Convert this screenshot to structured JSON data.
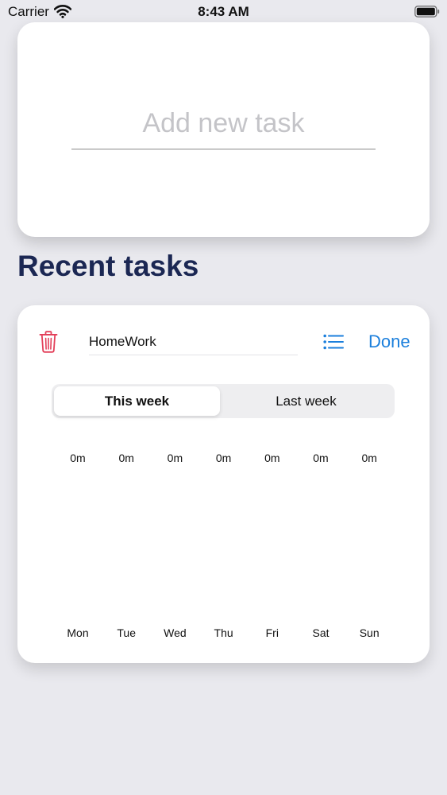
{
  "status_bar": {
    "carrier": "Carrier",
    "time": "8:43 AM"
  },
  "add_task": {
    "placeholder": "Add new task",
    "value": ""
  },
  "recent": {
    "title": "Recent tasks",
    "task": {
      "name": "HomeWork",
      "done_label": "Done"
    },
    "segments": {
      "this_week": "This week",
      "last_week": "Last week",
      "selected": "This week"
    },
    "chart_data": {
      "type": "bar",
      "categories": [
        "Mon",
        "Tue",
        "Wed",
        "Thu",
        "Fri",
        "Sat",
        "Sun"
      ],
      "values": [
        0,
        0,
        0,
        0,
        0,
        0,
        0
      ],
      "value_labels": [
        "0m",
        "0m",
        "0m",
        "0m",
        "0m",
        "0m",
        "0m"
      ]
    }
  },
  "colors": {
    "background": "#e9e9ee",
    "title": "#1b2753",
    "accent_blue": "#1b7fdc",
    "trash_red": "#e3405a"
  },
  "icons": {
    "wifi": "wifi-icon",
    "battery": "battery-icon",
    "trash": "trash-icon",
    "list": "list-icon"
  }
}
